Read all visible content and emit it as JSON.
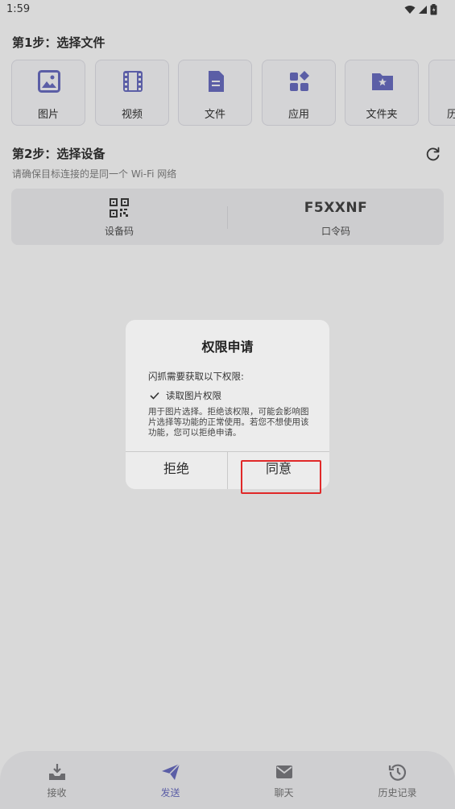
{
  "status_bar": {
    "time": "1:59"
  },
  "step1": {
    "title": "第1步：选择文件",
    "types": [
      {
        "label": "图片",
        "icon": "image-icon"
      },
      {
        "label": "视频",
        "icon": "video-icon"
      },
      {
        "label": "文件",
        "icon": "file-icon"
      },
      {
        "label": "应用",
        "icon": "apps-icon"
      },
      {
        "label": "文件夹",
        "icon": "folder-icon"
      },
      {
        "label": "历",
        "icon": "history-icon"
      }
    ]
  },
  "step2": {
    "title": "第2步：选择设备",
    "hint": "请确保目标连接的是同一个 Wi-Fi 网络",
    "qr_label": "设备码",
    "passcode": "F5XXNF",
    "passcode_label": "口令码"
  },
  "dialog": {
    "title": "权限申请",
    "intro": "闪抓需要获取以下权限:",
    "permission": "读取图片权限",
    "description": "用于图片选择。拒绝该权限，可能会影响图片选择等功能的正常使用。若您不想使用该功能，您可以拒绝申请。",
    "refuse_label": "拒绝",
    "agree_label": "同意"
  },
  "nav": {
    "items": [
      {
        "label": "接收",
        "icon": "receive-icon"
      },
      {
        "label": "发送",
        "icon": "send-icon"
      },
      {
        "label": "聊天",
        "icon": "chat-icon"
      },
      {
        "label": "历史记录",
        "icon": "history-icon"
      }
    ],
    "active": "发送"
  },
  "colors": {
    "accent": "#5b5ea6",
    "highlight": "#e02828",
    "overlay_bg": "#d9d9d9"
  }
}
